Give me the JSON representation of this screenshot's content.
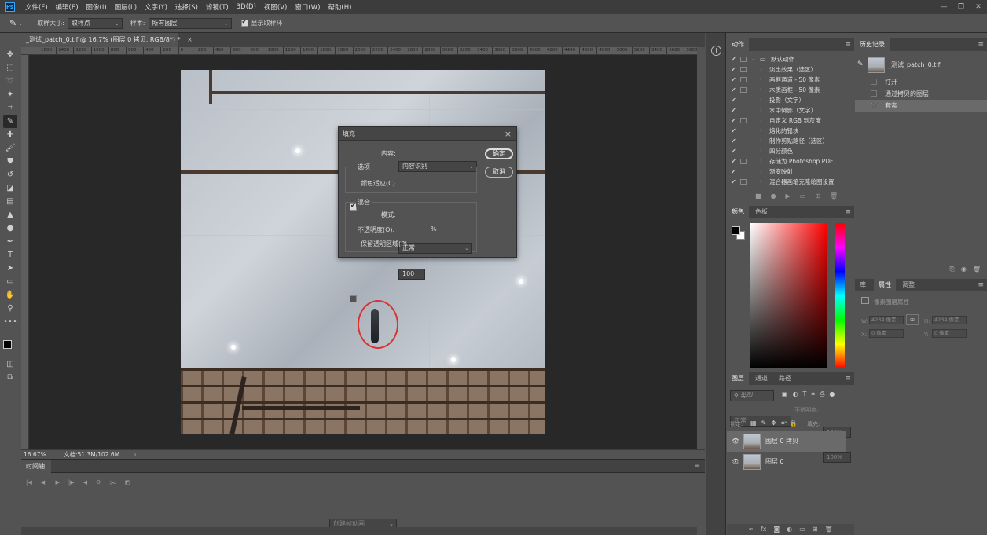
{
  "menubar": {
    "logo": "Ps",
    "items": [
      "文件(F)",
      "编辑(E)",
      "图像(I)",
      "图层(L)",
      "文字(Y)",
      "选择(S)",
      "滤镜(T)",
      "3D(D)",
      "视图(V)",
      "窗口(W)",
      "帮助(H)"
    ],
    "window_controls": [
      "—",
      "❐",
      "✕"
    ]
  },
  "options": {
    "sample_size_label": "取样大小:",
    "sample_size_value": "取样点",
    "sample_label": "样本:",
    "sample_value": "所有图层",
    "show_ring_label": "显示取样环"
  },
  "document": {
    "tab_title": "_测试_patch_0.tif @ 16.7% (图层 0 拷贝, RGB/8*) *",
    "tab_close": "×",
    "zoom": "16.67%",
    "doc_info": "文档:51.3M/102.6M",
    "ruler_ticks": [
      "1600",
      "1400",
      "1200",
      "1000",
      "800",
      "600",
      "400",
      "200",
      "0",
      "200",
      "400",
      "600",
      "800",
      "1000",
      "1200",
      "1400",
      "1600",
      "1800",
      "2000",
      "2200",
      "2400",
      "2600",
      "2800",
      "3000",
      "3200",
      "3400",
      "3600",
      "3800",
      "4000",
      "4200",
      "4400",
      "4600",
      "4800",
      "5000",
      "5200",
      "5400",
      "5600",
      "5800"
    ]
  },
  "fill_dialog": {
    "title": "填充",
    "content_label": "内容:",
    "content_value": "内容识别",
    "ok": "确定",
    "cancel": "取消",
    "options_label": "选项",
    "color_adapt_label": "颜色适应(C)",
    "blend_label": "混合",
    "mode_label": "模式:",
    "mode_value": "正常",
    "opacity_label": "不透明度(O):",
    "opacity_value": "100",
    "opacity_unit": "%",
    "preserve_label": "保留透明区域(P)"
  },
  "timeline": {
    "title": "时间轴",
    "create_label": "创建帧动画"
  },
  "actions_panel": {
    "tab": "动作",
    "set_name": "默认动作",
    "items": [
      "淡出效果（选区）",
      "画框通道 - 50 像素",
      "木质画框 - 50 像素",
      "投影（文字）",
      "水中倒影（文字）",
      "自定义 RGB 到灰度",
      "熔化的铅块",
      "存储为 Photoshop PDF",
      "四分颜色",
      "制作剪贴路径（选区）",
      "渐变映射",
      "混合器画笔克隆绘图设置"
    ]
  },
  "color_panel": {
    "tabs": [
      "颜色",
      "色板"
    ]
  },
  "history_panel": {
    "tab": "历史记录",
    "snapshot": "_测试_patch_0.tif",
    "items": [
      "打开",
      "通过拷贝的图层",
      "套索"
    ]
  },
  "props_panel": {
    "tabs": [
      "库",
      "属性",
      "调整"
    ],
    "title": "像素图层属性",
    "w_label": "W:",
    "w_value": "4234 像素",
    "h_label": "H:",
    "h_value": "4234 像素",
    "x_label": "X:",
    "x_value": "0 像素",
    "y_label": "Y:",
    "y_value": "0 像素"
  },
  "layers_panel": {
    "tabs": [
      "图层",
      "通道",
      "路径"
    ],
    "filter_label": "类型",
    "blend_mode": "正常",
    "opacity_label": "不透明度:",
    "opacity_value": "100%",
    "lock_label": "锁定:",
    "fill_label": "填充:",
    "fill_value": "100%",
    "layers": [
      "图层 0 拷贝",
      "图层 0"
    ]
  }
}
